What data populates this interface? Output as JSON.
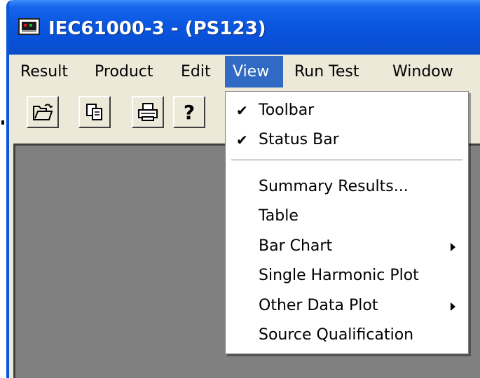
{
  "window": {
    "title": "IEC61000-3 - (PS123)"
  },
  "menubar": {
    "items": [
      {
        "label": "Result"
      },
      {
        "label": "Product"
      },
      {
        "label": "Edit"
      },
      {
        "label": "View"
      },
      {
        "label": "Run Test"
      },
      {
        "label": "Window"
      }
    ]
  },
  "toolbar": {
    "buttons": [
      {
        "icon": "open-folder-icon"
      },
      {
        "icon": "copy-icon"
      },
      {
        "icon": "print-icon"
      },
      {
        "icon": "help-icon",
        "glyph": "?"
      }
    ]
  },
  "view_menu": {
    "items": [
      {
        "label": "Toolbar",
        "checked": true,
        "check_glyph": "✔"
      },
      {
        "label": "Status Bar",
        "checked": true,
        "check_glyph": "✔"
      },
      {
        "label": "Summary Results..."
      },
      {
        "label": "Table"
      },
      {
        "label": "Bar Chart",
        "submenu": true
      },
      {
        "label": "Single Harmonic Plot"
      },
      {
        "label": "Other Data Plot",
        "submenu": true
      },
      {
        "label": "Source Qualification"
      }
    ]
  },
  "colors": {
    "titlebar": "#0a56e0",
    "menu_highlight": "#316ac5",
    "client_area": "#808080",
    "window_face": "#ece9d8"
  }
}
